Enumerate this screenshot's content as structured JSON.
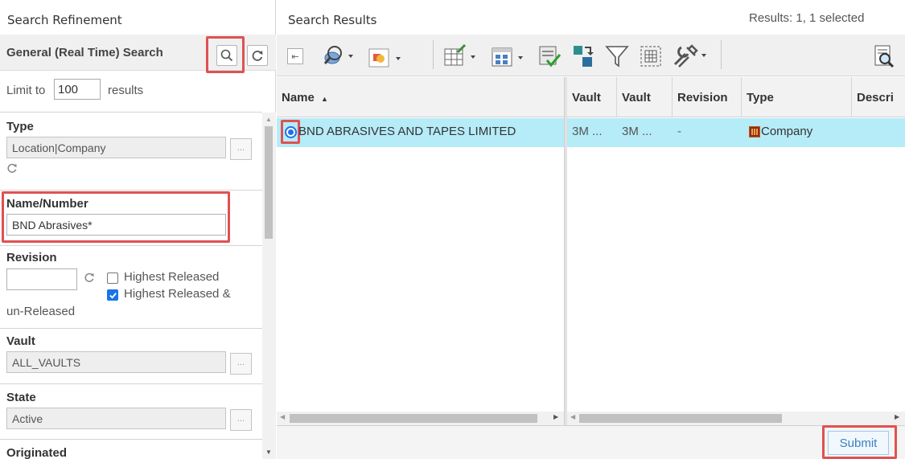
{
  "left_panel": {
    "title": "Search Refinement",
    "general_search_label": "General (Real Time) Search",
    "search_icon": "magnifier-icon",
    "refresh_icon": "refresh-icon",
    "limit": {
      "prefix": "Limit to",
      "value": "100",
      "suffix": "results"
    },
    "type": {
      "label": "Type",
      "value": "Location|Company",
      "browse": "..."
    },
    "name_number": {
      "label": "Name/Number",
      "value": "BND Abrasives*"
    },
    "revision": {
      "label": "Revision",
      "value": "",
      "highest_released": {
        "label": "Highest Released",
        "checked": false
      },
      "highest_released_unreleased": {
        "label_line1": "Highest Released &",
        "label_line2": "un-Released",
        "checked": true
      }
    },
    "vault": {
      "label": "Vault",
      "value": "ALL_VAULTS",
      "browse": "..."
    },
    "state": {
      "label": "State",
      "value": "Active",
      "browse": "..."
    },
    "originated": {
      "label": "Originated"
    }
  },
  "right_panel": {
    "title": "Search Results",
    "results_count": "Results: 1, 1 selected",
    "toolbar_icons": [
      "collapse-panel-icon",
      "find-like-icon",
      "shapes-icon",
      "edit-table-icon",
      "table-config-icon",
      "validate-icon",
      "export-icon",
      "filter-icon",
      "select-all-icon",
      "tools-icon",
      "search-icon"
    ],
    "columns": [
      "Name",
      "Vault",
      "Vault",
      "Revision",
      "Type",
      "Descri"
    ],
    "rows": [
      {
        "name": "BND ABRASIVES AND TAPES LIMITED",
        "vault1": "3M ...",
        "vault2": "3M ...",
        "revision": "-",
        "type": "Company",
        "description": ""
      }
    ],
    "submit_label": "Submit"
  },
  "colors": {
    "selected_row": "#b6ebf8",
    "highlight": "#e05151",
    "accent": "#1a73e8"
  }
}
